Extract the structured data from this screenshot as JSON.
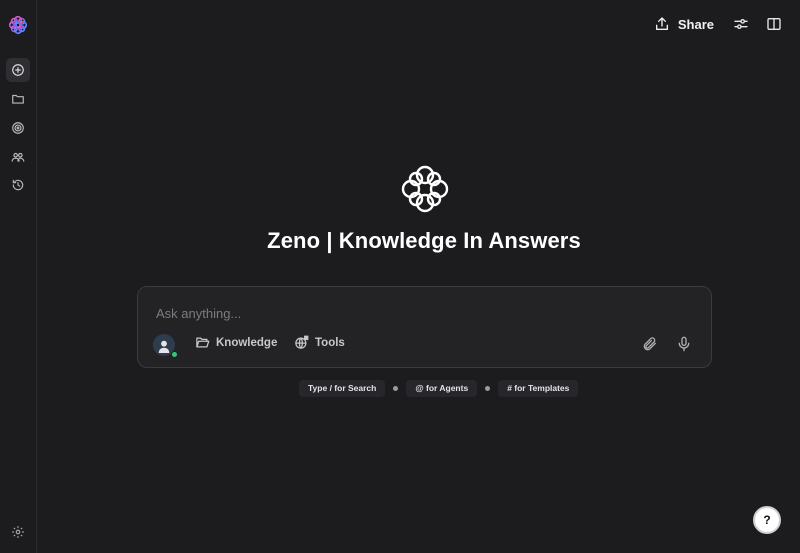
{
  "header": {
    "share_label": "Share"
  },
  "hero": {
    "title": "Zeno | Knowledge In Answers"
  },
  "composer": {
    "placeholder": "Ask anything...",
    "knowledge_label": "Knowledge",
    "tools_label": "Tools"
  },
  "hints": [
    "Type / for Search",
    "@ for Agents",
    "# for Templates"
  ],
  "help": {
    "label": "?"
  },
  "colors": {
    "background": "#1c1c1e",
    "composer_bg": "#232326",
    "status_online": "#2ecc71",
    "logo_gradient": [
      "#ff5fa2",
      "#8a5cff",
      "#3da9ff"
    ]
  },
  "icons": {
    "sidebar": [
      "new-chat-icon",
      "folder-icon",
      "target-icon",
      "users-icon",
      "history-icon"
    ],
    "toolbar": [
      "share-icon",
      "sliders-icon",
      "split-view-icon"
    ],
    "composer": [
      "user-icon",
      "folder-open-icon",
      "globe-tools-icon",
      "paperclip-icon",
      "microphone-icon"
    ],
    "bottom": [
      "settings-icon",
      "help-icon"
    ]
  }
}
